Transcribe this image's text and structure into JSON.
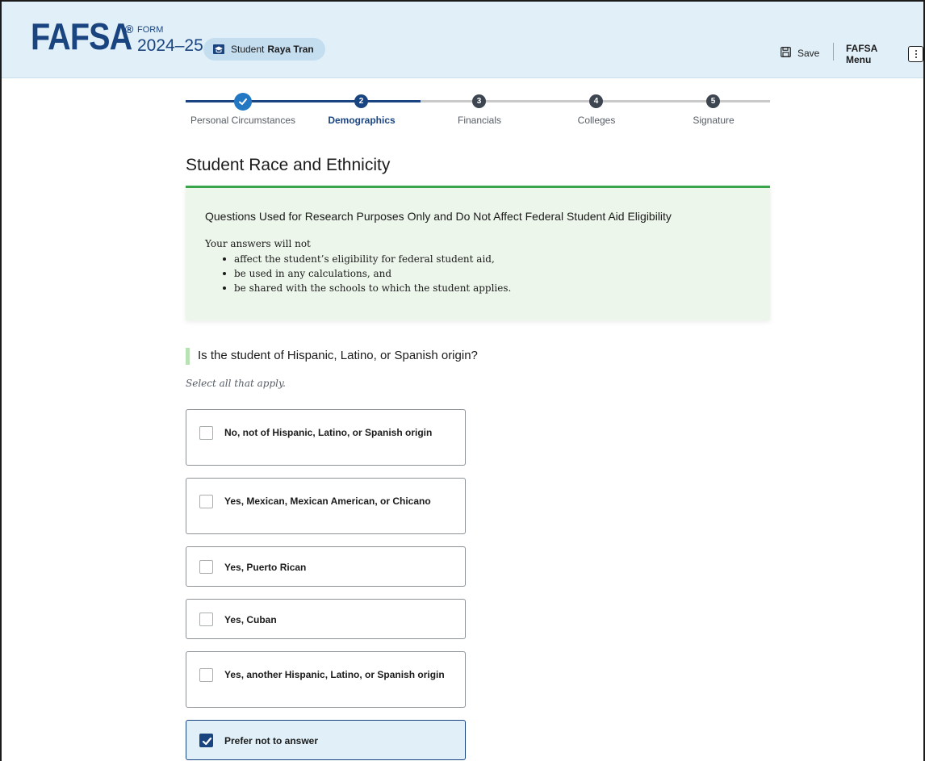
{
  "header": {
    "logo": "FAFSA",
    "logo_mark": "®",
    "form_label": "FORM",
    "form_year": "2024–25",
    "student_prefix": "Student",
    "student_name": "Raya Tran",
    "save_label": "Save",
    "menu_label": "FAFSA Menu",
    "student_icon": "graduation-cap-icon",
    "save_icon": "floppy-disk-icon",
    "menu_icon": "kebab-icon"
  },
  "stepper": {
    "steps": [
      {
        "number": "1",
        "label": "Personal Circumstances",
        "status": "complete"
      },
      {
        "number": "2",
        "label": "Demographics",
        "status": "current"
      },
      {
        "number": "3",
        "label": "Financials",
        "status": "upcoming"
      },
      {
        "number": "4",
        "label": "Colleges",
        "status": "upcoming"
      },
      {
        "number": "5",
        "label": "Signature",
        "status": "upcoming"
      }
    ]
  },
  "page": {
    "title": "Student Race and Ethnicity"
  },
  "info_box": {
    "heading": "Questions Used for Research Purposes Only and Do Not Affect Federal Student Aid Eligibility",
    "intro": "Your answers will not",
    "items": [
      "affect the student’s eligibility for federal student aid,",
      "be used in any calculations, and",
      "be shared with the schools to which the student applies."
    ]
  },
  "question": {
    "text": "Is the student of Hispanic, Latino, or Spanish origin?",
    "hint": "Select all that apply.",
    "options": [
      {
        "label": "No, not of Hispanic, Latino, or Spanish origin",
        "checked": false
      },
      {
        "label": "Yes, Mexican, Mexican American, or Chicano",
        "checked": false
      },
      {
        "label": "Yes, Puerto Rican",
        "checked": false
      },
      {
        "label": "Yes, Cuban",
        "checked": false
      },
      {
        "label": "Yes, another Hispanic, Latino, or Spanish origin",
        "checked": false
      },
      {
        "label": "Prefer not to answer",
        "checked": true
      }
    ]
  },
  "colors": {
    "brand_blue": "#1a4480",
    "header_bg": "#e1f0f8",
    "info_accent": "#38a54a",
    "info_bg": "#ecf6ea"
  }
}
